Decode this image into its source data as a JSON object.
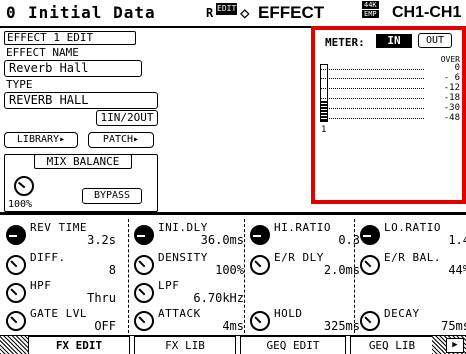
{
  "header": {
    "scene_number": "0",
    "scene_name": "Initial Data",
    "edit_badge": "EDIT",
    "r_badge": "R",
    "screen_name": "EFFECT",
    "diamond": "◇",
    "fs_top": "44K",
    "fs_bottom": "EMP",
    "channel": "CH1-CH1"
  },
  "effect": {
    "edit_title": "EFFECT 1 EDIT",
    "name_label": "EFFECT NAME",
    "name_value": "Reverb Hall",
    "type_label": "TYPE",
    "type_value": "REVERB HALL",
    "io_config": "1IN/2OUT",
    "library_button": "LIBRARY",
    "patch_button": "PATCH",
    "mix_balance_label": "MIX BALANCE",
    "mix_balance_value": "100%",
    "bypass_button": "BYPASS"
  },
  "meter": {
    "label": "METER:",
    "in_button": "IN",
    "out_button": "OUT",
    "scale": [
      "OVER",
      "0",
      "- 6",
      "-12",
      "-18",
      "-30",
      "-48"
    ],
    "channel_label": "1",
    "level_fraction": 0.35,
    "highlight_color": "#e00000"
  },
  "params": [
    {
      "name": "REV TIME",
      "value": "3.2s",
      "knob": "filled"
    },
    {
      "name": "INI.DLY",
      "value": "36.0ms",
      "knob": "filled"
    },
    {
      "name": "HI.RATIO",
      "value": "0.3",
      "knob": "filled"
    },
    {
      "name": "LO.RATIO",
      "value": "1.4",
      "knob": "filled"
    },
    {
      "name": "DIFF.",
      "value": "8",
      "knob": "open"
    },
    {
      "name": "DENSITY",
      "value": "100%",
      "knob": "open"
    },
    {
      "name": "E/R DLY",
      "value": "2.0ms",
      "knob": "open"
    },
    {
      "name": "E/R BAL.",
      "value": "44%",
      "knob": "open"
    },
    {
      "name": "HPF",
      "value": "Thru",
      "knob": "open"
    },
    {
      "name": "LPF",
      "value": "6.70kHz",
      "knob": "open"
    },
    {
      "name": "",
      "value": "",
      "knob": "none"
    },
    {
      "name": "",
      "value": "",
      "knob": "none"
    },
    {
      "name": "GATE LVL",
      "value": "OFF",
      "knob": "open"
    },
    {
      "name": "ATTACK",
      "value": "4ms",
      "knob": "open"
    },
    {
      "name": "HOLD",
      "value": "325ms",
      "knob": "open"
    },
    {
      "name": "DECAY",
      "value": "75ms",
      "knob": "open"
    }
  ],
  "tabs": [
    "FX EDIT",
    "FX LIB",
    "GEQ EDIT",
    "GEQ LIB"
  ],
  "tab_next": "▶"
}
